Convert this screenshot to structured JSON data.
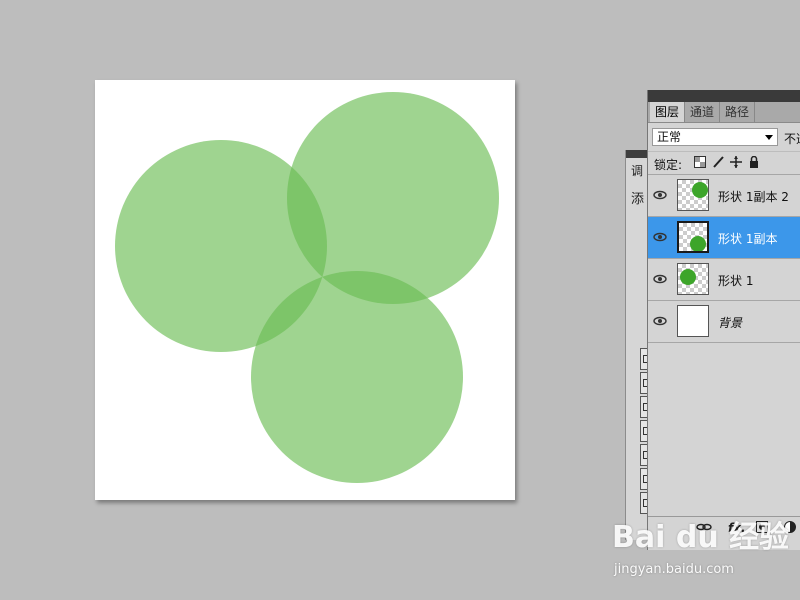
{
  "colors": {
    "workspace": "#bdbdbd",
    "circle_fill": "#6cbd54",
    "selection": "#3c97ea",
    "thumb_dot": "#3da52a"
  },
  "adjust_panel": {
    "tab_label": "调",
    "add_label": "添"
  },
  "layers_panel": {
    "tabs": [
      {
        "label": "图层"
      },
      {
        "label": "通道"
      },
      {
        "label": "路径"
      }
    ],
    "blend_mode": "正常",
    "opacity_label": "不透",
    "lock_label": "锁定:",
    "lock_icons": [
      "lock-transparent-icon",
      "lock-paint-icon",
      "lock-move-icon",
      "lock-all-icon"
    ],
    "layers": [
      {
        "name": "形状 1副本 2",
        "selected": false
      },
      {
        "name": "形状 1副本",
        "selected": true
      },
      {
        "name": "形状 1",
        "selected": false
      },
      {
        "name": "背景",
        "selected": false
      }
    ],
    "footer": {
      "fx_label": "fx."
    }
  },
  "watermark": {
    "logo": "Bai du 经验",
    "url": "jingyan.baidu.com"
  }
}
